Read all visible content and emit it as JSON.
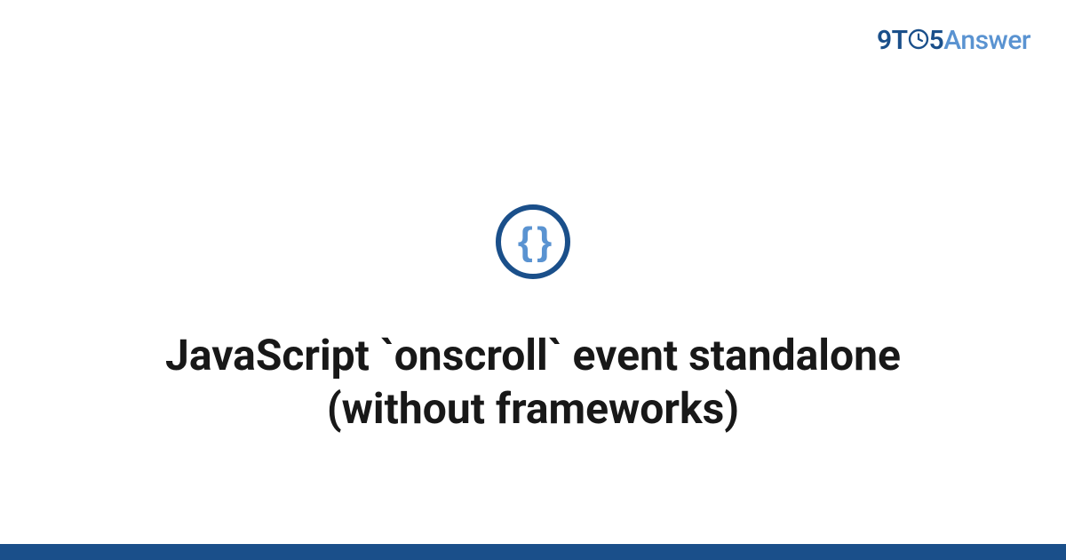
{
  "brand": {
    "prefix": "9T",
    "middle": "5",
    "suffix": "Answer"
  },
  "icon": {
    "glyph": "{ }",
    "name": "code-braces-icon"
  },
  "title": "JavaScript `onscroll` event standalone (without frameworks)",
  "colors": {
    "accent_dark": "#1a4f8a",
    "accent_light": "#5a93d1"
  }
}
